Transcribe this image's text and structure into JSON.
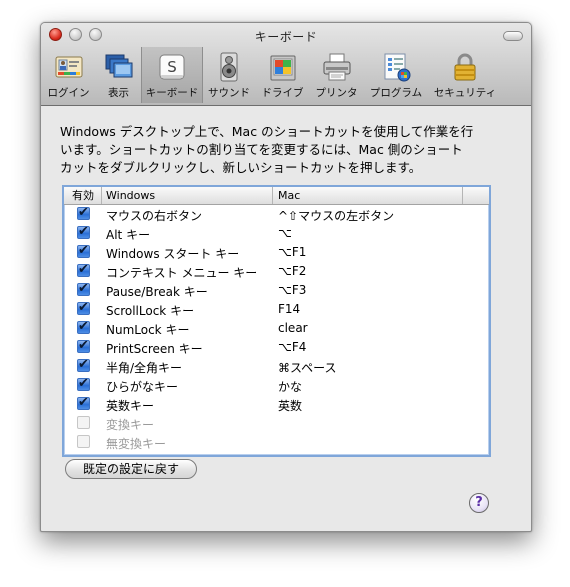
{
  "window": {
    "title": "キーボード"
  },
  "toolbar": {
    "items": [
      {
        "label": "ログイン",
        "icon": "login-icon"
      },
      {
        "label": "表示",
        "icon": "display-icon"
      },
      {
        "label": "キーボード",
        "icon": "keyboard-icon",
        "selected": true
      },
      {
        "label": "サウンド",
        "icon": "speaker-icon"
      },
      {
        "label": "ドライブ",
        "icon": "drive-icon"
      },
      {
        "label": "プリンタ",
        "icon": "printer-icon"
      },
      {
        "label": "プログラム",
        "icon": "programs-icon"
      },
      {
        "label": "セキュリティ",
        "icon": "lock-icon"
      }
    ]
  },
  "keyboard_icon_letter": "S",
  "description": {
    "line1": "Windows デスクトップ上で、Mac のショートカットを使用して作業を行",
    "line2": "います。ショートカットの割り当てを変更するには、Mac 側のショート",
    "line3": "カットをダブルクリックし、新しいショートカットを押します。"
  },
  "table": {
    "headers": {
      "enabled": "有効",
      "windows": "Windows",
      "mac": "Mac"
    },
    "rows": [
      {
        "enabled": true,
        "windows": "マウスの右ボタン",
        "mac": "^⇧マウスの左ボタン"
      },
      {
        "enabled": true,
        "windows": "Alt キー",
        "mac": "⌥"
      },
      {
        "enabled": true,
        "windows": "Windows スタート キー",
        "mac": "⌥F1"
      },
      {
        "enabled": true,
        "windows": "コンテキスト メニュー キー",
        "mac": "⌥F2"
      },
      {
        "enabled": true,
        "windows": "Pause/Break キー",
        "mac": "⌥F3"
      },
      {
        "enabled": true,
        "windows": "ScrollLock キー",
        "mac": "F14"
      },
      {
        "enabled": true,
        "windows": "NumLock キー",
        "mac": "clear"
      },
      {
        "enabled": true,
        "windows": "PrintScreen キー",
        "mac": "⌥F4"
      },
      {
        "enabled": true,
        "windows": "半角/全角キー",
        "mac": "⌘スペース"
      },
      {
        "enabled": true,
        "windows": "ひらがなキー",
        "mac": "かな"
      },
      {
        "enabled": true,
        "windows": "英数キー",
        "mac": "英数"
      },
      {
        "enabled": false,
        "windows": "変換キー",
        "mac": ""
      },
      {
        "enabled": false,
        "windows": "無変換キー",
        "mac": ""
      }
    ]
  },
  "buttons": {
    "reset": "既定の設定に戻す",
    "help": "?"
  },
  "colors": {
    "selection_border": "#7fa6d9",
    "checkbox_blue": "#2a6fd6",
    "help_purple": "#5a2ea6"
  }
}
